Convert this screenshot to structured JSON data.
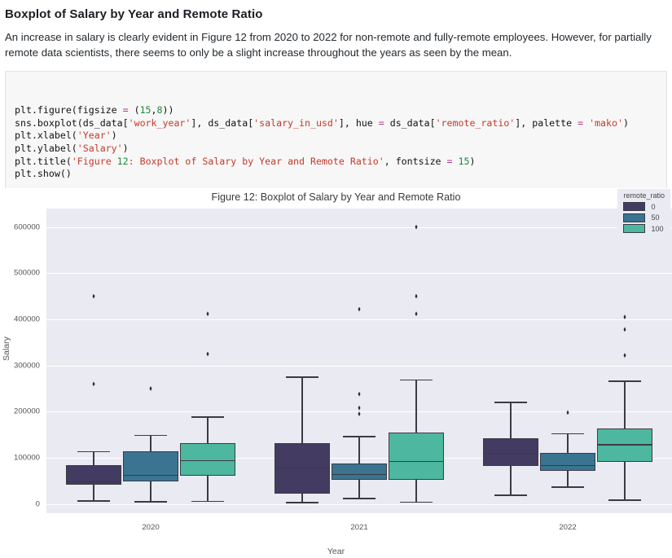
{
  "heading": "Boxplot of Salary by Year and Remote Ratio",
  "paragraph": "An increase in salary is clearly evident in Figure 12 from 2020 to 2022 for non-remote and fully-remote employees. However, for partially remote data scientists, there seems to only be a slight increase throughout the years as seen by the mean.",
  "code": {
    "lines": [
      "plt.figure(figsize = (15,8))",
      "sns.boxplot(ds_data['work_year'], ds_data['salary_in_usd'], hue = ds_data['remote_ratio'], palette = 'mako')",
      "plt.xlabel('Year')",
      "plt.ylabel('Salary')",
      "plt.title('Figure 12: Boxplot of Salary by Year and Remote Ratio', fontsize = 15)",
      "plt.show()"
    ]
  },
  "chart_data": {
    "type": "box",
    "title": "Figure 12: Boxplot of Salary by Year and Remote Ratio",
    "xlabel": "Year",
    "ylabel": "Salary",
    "categories": [
      "2020",
      "2021",
      "2022"
    ],
    "ylim": [
      -20000,
      640000
    ],
    "yticks": [
      0,
      100000,
      200000,
      300000,
      400000,
      500000,
      600000
    ],
    "ytick_labels": [
      "0",
      "100000",
      "200000",
      "300000",
      "400000",
      "500000",
      "600000"
    ],
    "grid": true,
    "legend": {
      "title": "remote_ratio",
      "position": "upper right",
      "entries": [
        {
          "label": "0",
          "color": "#433b61"
        },
        {
          "label": "50",
          "color": "#3a7491"
        },
        {
          "label": "100",
          "color": "#4db79f"
        }
      ]
    },
    "series": [
      {
        "name": "0",
        "color": "#433b61",
        "boxes": [
          {
            "category": "2020",
            "whisker_low": 8000,
            "q1": 42000,
            "median": 48000,
            "q3": 85000,
            "whisker_high": 115000,
            "fliers": [
              450000,
              260000
            ]
          },
          {
            "category": "2021",
            "whisker_low": 4000,
            "q1": 22000,
            "median": 78000,
            "q3": 131000,
            "whisker_high": 276000,
            "fliers": []
          },
          {
            "category": "2022",
            "whisker_low": 20000,
            "q1": 83000,
            "median": 110000,
            "q3": 142000,
            "whisker_high": 221000,
            "fliers": []
          }
        ]
      },
      {
        "name": "50",
        "color": "#3a7491",
        "boxes": [
          {
            "category": "2020",
            "whisker_low": 6000,
            "q1": 48000,
            "median": 62000,
            "q3": 114000,
            "whisker_high": 150000,
            "fliers": [
              250000
            ]
          },
          {
            "category": "2021",
            "whisker_low": 13000,
            "q1": 53000,
            "median": 64000,
            "q3": 87000,
            "whisker_high": 147000,
            "fliers": [
              422000,
              238000,
              208000,
              195000
            ]
          },
          {
            "category": "2022",
            "whisker_low": 38000,
            "q1": 72000,
            "median": 83000,
            "q3": 110000,
            "whisker_high": 153000,
            "fliers": [
              198000
            ]
          }
        ]
      },
      {
        "name": "100",
        "color": "#4db79f",
        "boxes": [
          {
            "category": "2020",
            "whisker_low": 7000,
            "q1": 62000,
            "median": 94000,
            "q3": 131000,
            "whisker_high": 190000,
            "fliers": [
              412000,
              325000
            ]
          },
          {
            "category": "2021",
            "whisker_low": 5000,
            "q1": 53000,
            "median": 92000,
            "q3": 155000,
            "whisker_high": 270000,
            "fliers": [
              600000,
              450000,
              412000
            ]
          },
          {
            "category": "2022",
            "whisker_low": 10000,
            "q1": 92000,
            "median": 128000,
            "q3": 163000,
            "whisker_high": 267000,
            "fliers": [
              405000,
              378000,
              322000
            ]
          }
        ]
      }
    ]
  }
}
